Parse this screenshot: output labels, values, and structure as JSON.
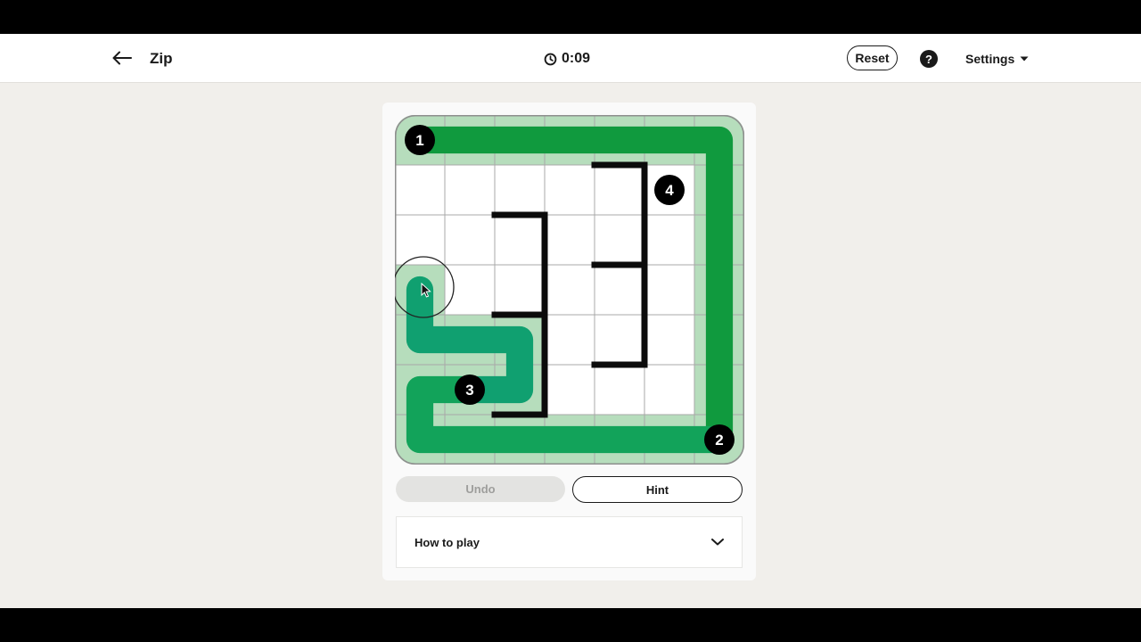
{
  "app": {
    "title": "Zip"
  },
  "timer": {
    "value": "0:09"
  },
  "header": {
    "reset_label": "Reset",
    "help_label": "?",
    "settings_label": "Settings"
  },
  "controls": {
    "undo_label": "Undo",
    "hint_label": "Hint"
  },
  "how_to_play": {
    "label": "How to play"
  },
  "board": {
    "rows": 7,
    "cols": 7,
    "numbers": [
      {
        "label": "1",
        "row": 0,
        "col": 0
      },
      {
        "label": "2",
        "row": 6,
        "col": 6
      },
      {
        "label": "3",
        "row": 5,
        "col": 1
      },
      {
        "label": "4",
        "row": 1,
        "col": 5
      }
    ],
    "walls": [
      {
        "type": "h",
        "row": 2,
        "col": 2
      },
      {
        "type": "v",
        "row": 2,
        "col": 2
      },
      {
        "type": "v",
        "row": 3,
        "col": 2
      },
      {
        "type": "h",
        "row": 4,
        "col": 2
      },
      {
        "type": "v",
        "row": 4,
        "col": 2
      },
      {
        "type": "v",
        "row": 5,
        "col": 2
      },
      {
        "type": "h",
        "row": 6,
        "col": 2
      },
      {
        "type": "h",
        "row": 1,
        "col": 4
      },
      {
        "type": "v",
        "row": 1,
        "col": 4
      },
      {
        "type": "v",
        "row": 2,
        "col": 4
      },
      {
        "type": "h",
        "row": 3,
        "col": 4
      },
      {
        "type": "v",
        "row": 3,
        "col": 4
      },
      {
        "type": "v",
        "row": 4,
        "col": 4
      },
      {
        "type": "h",
        "row": 5,
        "col": 4
      }
    ],
    "path_segments": [
      {
        "color": "#109a3e",
        "cells": [
          [
            0,
            0
          ],
          [
            0,
            1
          ],
          [
            0,
            2
          ],
          [
            0,
            3
          ],
          [
            0,
            4
          ],
          [
            0,
            5
          ],
          [
            0,
            6
          ],
          [
            1,
            6
          ],
          [
            2,
            6
          ],
          [
            3,
            6
          ],
          [
            4,
            6
          ],
          [
            5,
            6
          ],
          [
            6,
            6
          ]
        ]
      },
      {
        "color": "#12a35a",
        "cells": [
          [
            6,
            6
          ],
          [
            6,
            5
          ],
          [
            6,
            4
          ],
          [
            6,
            3
          ],
          [
            6,
            2
          ],
          [
            6,
            1
          ],
          [
            6,
            0
          ],
          [
            5,
            0
          ],
          [
            5,
            1
          ]
        ]
      },
      {
        "color": "#10a070",
        "cells": [
          [
            5,
            1
          ],
          [
            5,
            2
          ],
          [
            4,
            2
          ],
          [
            4,
            1
          ],
          [
            4,
            0
          ],
          [
            3,
            0
          ]
        ]
      }
    ],
    "colors": {
      "cell": "#ffffff",
      "filled_cell": "#b6ddbc",
      "grid_line": "#a8a8a8",
      "board_border": "#8e8e8e",
      "wall": "#0b0b0b",
      "number_bg": "#000000",
      "number_text": "#ffffff"
    },
    "cursor": {
      "row": 3,
      "col": 0
    }
  }
}
